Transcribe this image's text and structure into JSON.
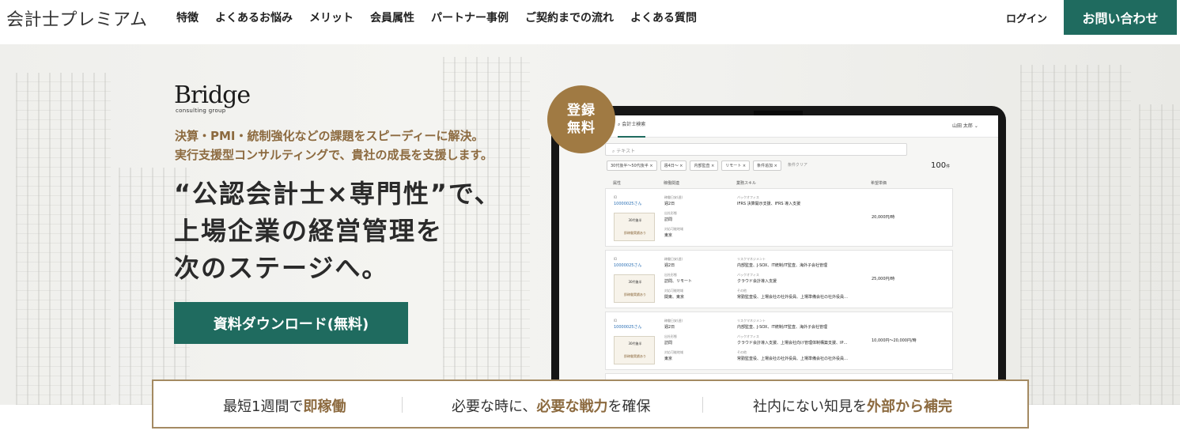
{
  "header": {
    "site_title": "会計士プレミアム",
    "nav": [
      "特徴",
      "よくあるお悩み",
      "メリット",
      "会員属性",
      "パートナー事例",
      "ご契約までの流れ",
      "よくある質問"
    ],
    "login": "ログイン",
    "contact": "お問い合わせ"
  },
  "colors": {
    "accent_green": "#1f6b5f",
    "accent_gold": "#a07a43"
  },
  "hero": {
    "logo_main": "Bridge",
    "logo_sub": "consulting group",
    "tagline_1": "決算・PMI・統制強化などの課題をスピーディーに解決。",
    "tagline_2": "実行支援型コンサルティングで、貴社の成長を支援します。",
    "headline_1": "“公認会計士×専門性”で、",
    "headline_2": "上場企業の経営管理を",
    "headline_3": "次のステージへ。",
    "download": "資料ダウンロード(無料)",
    "badge_1": "登録",
    "badge_2": "無料"
  },
  "screen": {
    "tab": "会計士検索",
    "user": "山田 太郎",
    "search_placeholder": "テキスト",
    "filters": [
      "30代後半〜50代後半 ×",
      "週4日〜 ×",
      "内部監査 ×",
      "リモート ×",
      "条件追加 ×",
      "条件クリア"
    ],
    "count": "100",
    "count_unit": "件",
    "columns": [
      "属性",
      "稼働関連",
      "業務スキル",
      "希望単価"
    ],
    "rows": [
      {
        "id": "10000025さん",
        "age": "30代後半",
        "note": "即稼働実績あり",
        "l1": "稼働日安(週)",
        "v1": "週2日",
        "l2": "出社形態",
        "v2": "訪問",
        "l3": "対応可能地域",
        "v3": "東京",
        "s1l": "バックオフィス",
        "s1v": "IFRS 決算開示支援、IFRS 導入支援",
        "s2l": "",
        "s2v": "",
        "s3l": "",
        "s3v": "",
        "price": "20,000円/時"
      },
      {
        "id": "10000025さん",
        "age": "30代後半",
        "note": "即稼働実績あり",
        "l1": "稼働日安(週)",
        "v1": "週2日",
        "l2": "出社形態",
        "v2": "訪問、リモート",
        "l3": "対応可能地域",
        "v3": "関東、東京",
        "s1l": "リスクマネジメント",
        "s1v": "内部監査、J-SOX、IT統制/IT監査、海外子会社管理",
        "s2l": "バックオフィス",
        "s2v": "クラウド会計導入支援",
        "s3l": "その他",
        "s3v": "常勤監査役、上場会社の社外役員、上場準備会社の社外役員…",
        "price": "25,000円/時"
      },
      {
        "id": "10000025さん",
        "age": "30代後半",
        "note": "即稼働実績あり",
        "l1": "稼働日安(週)",
        "v1": "週2日",
        "l2": "出社形態",
        "v2": "訪問",
        "l3": "対応可能地域",
        "v3": "東京",
        "s1l": "リスクマネジメント",
        "s1v": "内部監査、J-SOX、IT統制/IT監査、海外子会社管理",
        "s2l": "バックオフィス",
        "s2v": "クラウド会計導入支援、上場会社向け管理体制構築支援、IP…",
        "s3l": "その他",
        "s3v": "常勤監査役、上場会社の社外役員、上場準備会社の社外役員…",
        "price": "10,000円〜20,000円/時"
      }
    ]
  },
  "benefits": [
    {
      "pre": "最短1週間で",
      "em": "即稼働",
      "post": ""
    },
    {
      "pre": "必要な時に、",
      "em": "必要な戦力",
      "post": "を確保"
    },
    {
      "pre": "社内にない知見を",
      "em": "外部から補完",
      "post": ""
    }
  ]
}
